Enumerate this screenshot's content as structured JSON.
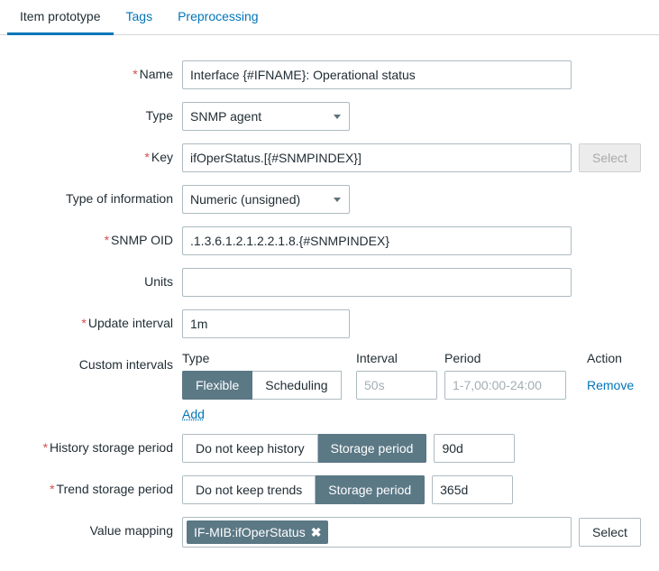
{
  "tabs": {
    "item_prototype": "Item prototype",
    "tags": "Tags",
    "preprocessing": "Preprocessing"
  },
  "labels": {
    "name": "Name",
    "type": "Type",
    "key": "Key",
    "type_info": "Type of information",
    "snmp_oid": "SNMP OID",
    "units": "Units",
    "update_interval": "Update interval",
    "custom_intervals": "Custom intervals",
    "history_period": "History storage period",
    "trend_period": "Trend storage period",
    "value_mapping": "Value mapping"
  },
  "values": {
    "name": "Interface {#IFNAME}: Operational status",
    "type": "SNMP agent",
    "key": "ifOperStatus.[{#SNMPINDEX}]",
    "type_info": "Numeric (unsigned)",
    "snmp_oid": ".1.3.6.1.2.1.2.2.1.8.{#SNMPINDEX}",
    "units": "",
    "update_interval": "1m",
    "history_value": "90d",
    "trend_value": "365d",
    "vm_chip": "IF-MIB:ifOperStatus"
  },
  "custom_intervals": {
    "head_type": "Type",
    "head_interval": "Interval",
    "head_period": "Period",
    "head_action": "Action",
    "seg_flexible": "Flexible",
    "seg_scheduling": "Scheduling",
    "ph_interval": "50s",
    "ph_period": "1-7,00:00-24:00",
    "remove": "Remove",
    "add": "Add"
  },
  "buttons": {
    "select": "Select",
    "do_not_keep_history": "Do not keep history",
    "storage_period": "Storage period",
    "do_not_keep_trends": "Do not keep trends"
  }
}
